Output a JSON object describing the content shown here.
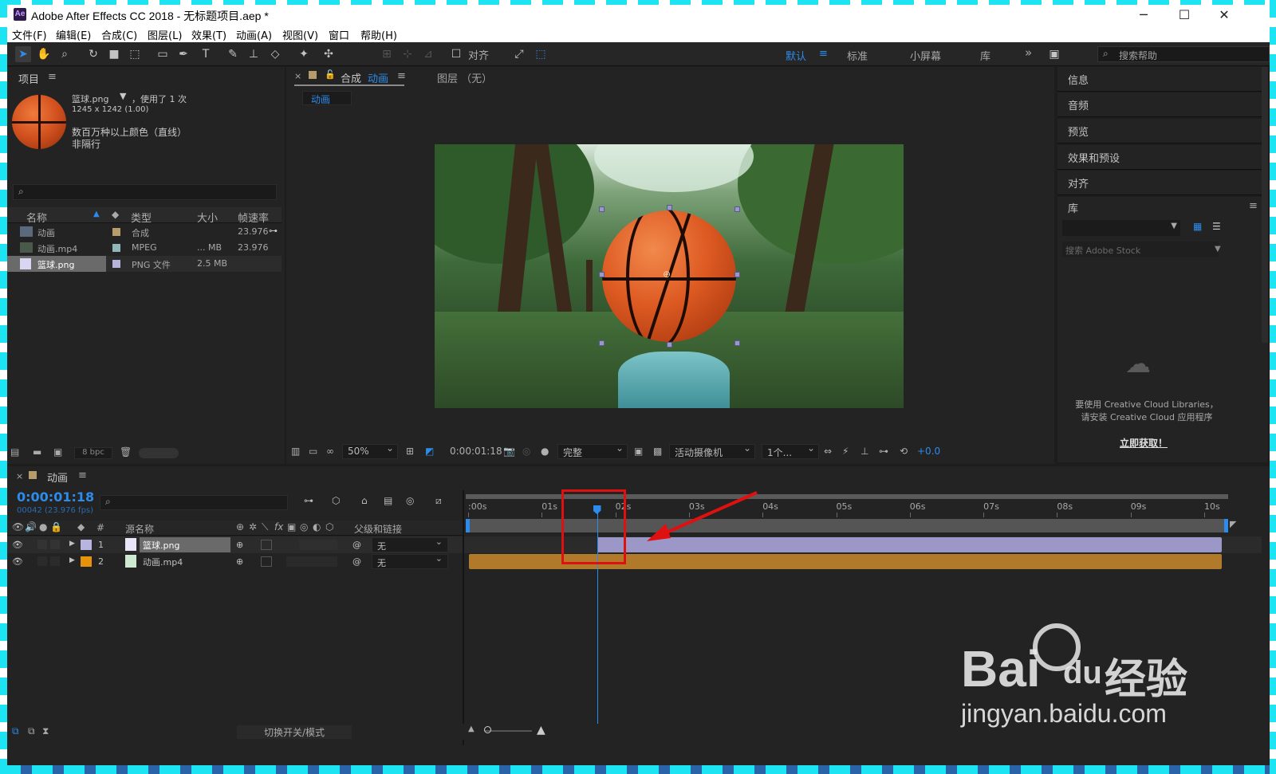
{
  "window": {
    "app_icon": "Ae",
    "title": "Adobe After Effects CC 2018 - 无标题项目.aep *",
    "minimize": "─",
    "maximize": "☐",
    "close": "✕"
  },
  "menu": [
    "文件(F)",
    "编辑(E)",
    "合成(C)",
    "图层(L)",
    "效果(T)",
    "动画(A)",
    "视图(V)",
    "窗口",
    "帮助(H)"
  ],
  "toolbar": {
    "align_label": "对齐",
    "workspaces": [
      "默认",
      "标准",
      "小屏幕",
      "库"
    ],
    "active_workspace": "默认",
    "more": "»",
    "help_placeholder": "搜索帮助"
  },
  "project": {
    "panel_title": "项目",
    "selected_name": "篮球.png",
    "usage": "，使用了 1 次",
    "dimensions": "1245 x 1242 (1.00)",
    "color_info": "数百万种以上颜色（直线）",
    "interlace": "非隔行",
    "search_icon": "⌕",
    "columns": [
      "名称",
      "类型",
      "大小",
      "帧速率"
    ],
    "items": [
      {
        "name": "动画",
        "type": "合成",
        "size": "",
        "fps": "23.976",
        "color": "#b59c6a"
      },
      {
        "name": "动画.mp4",
        "type": "MPEG",
        "size": "... MB",
        "fps": "23.976",
        "color": "#8fb7b7"
      },
      {
        "name": "篮球.png",
        "type": "PNG 文件",
        "size": "2.5 MB",
        "fps": "",
        "color": "#b5b3d9"
      }
    ],
    "bpc": "8 bpc"
  },
  "composition": {
    "tab_prefix": "合成",
    "tab_name": "动画",
    "layer_tab": "图层 （无）",
    "breadcrumb": "动画",
    "zoom": "50%",
    "timecode": "0:00:01:18",
    "resolution": "完整",
    "camera": "活动摄像机",
    "views": "1个...",
    "exposure": "+0.0"
  },
  "right_panel": {
    "items": [
      "信息",
      "音频",
      "预览",
      "效果和预设",
      "对齐",
      "库"
    ],
    "stock_placeholder": "搜索 Adobe Stock",
    "cc_message_line1": "要使用 Creative Cloud Libraries，",
    "cc_message_line2": "请安装 Creative Cloud 应用程序",
    "get_link": "立即获取！"
  },
  "timeline": {
    "comp_name": "动画",
    "timecode": "0:00:01:18",
    "frame_info": "00042 (23.976 fps)",
    "col_source": "源名称",
    "col_parent": "父级和链接",
    "col_num": "#",
    "layers": [
      {
        "num": "1",
        "name": "篮球.png",
        "parent": "无",
        "color": "#b7b4e0"
      },
      {
        "num": "2",
        "name": "动画.mp4",
        "parent": "无",
        "color": "#e8930c"
      }
    ],
    "ruler": [
      ":00s",
      "01s",
      "02s",
      "03s",
      "04s",
      "05s",
      "06s",
      "07s",
      "08s",
      "09s",
      "10s"
    ],
    "playhead_seconds": 1.75,
    "switch_mode": "切换开关/模式"
  },
  "watermark": {
    "brand": "Bai",
    "brand2": "du",
    "cn": "经验",
    "url": "jingyan.baidu.com"
  }
}
